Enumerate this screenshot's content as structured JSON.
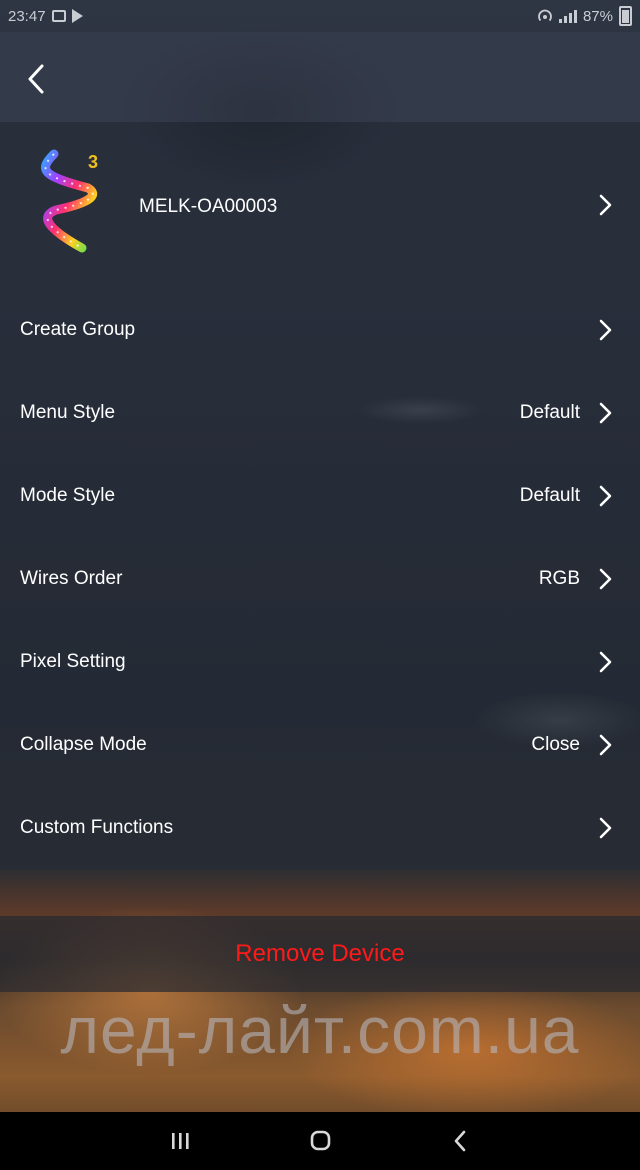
{
  "status_bar": {
    "time": "23:47",
    "battery": "87%",
    "icons": [
      "image-icon",
      "play-store-icon",
      "hotspot-icon",
      "signal-icon",
      "battery-icon"
    ]
  },
  "header": {
    "back_icon": "chevron-left-icon"
  },
  "device": {
    "name": "MELK-OA00003",
    "logo_badge": "3"
  },
  "settings": [
    {
      "label": "Create Group",
      "value": ""
    },
    {
      "label": "Menu Style",
      "value": "Default"
    },
    {
      "label": "Mode Style",
      "value": "Default"
    },
    {
      "label": "Wires Order",
      "value": "RGB"
    },
    {
      "label": "Pixel Setting",
      "value": ""
    },
    {
      "label": "Collapse Mode",
      "value": "Close"
    },
    {
      "label": "Custom Functions",
      "value": ""
    }
  ],
  "remove_device": {
    "label": "Remove Device",
    "color": "#ff1a1a"
  },
  "watermark": "лед-лайт.com.ua",
  "nav": {
    "icons": [
      "recent-apps-icon",
      "home-icon",
      "back-icon"
    ]
  }
}
